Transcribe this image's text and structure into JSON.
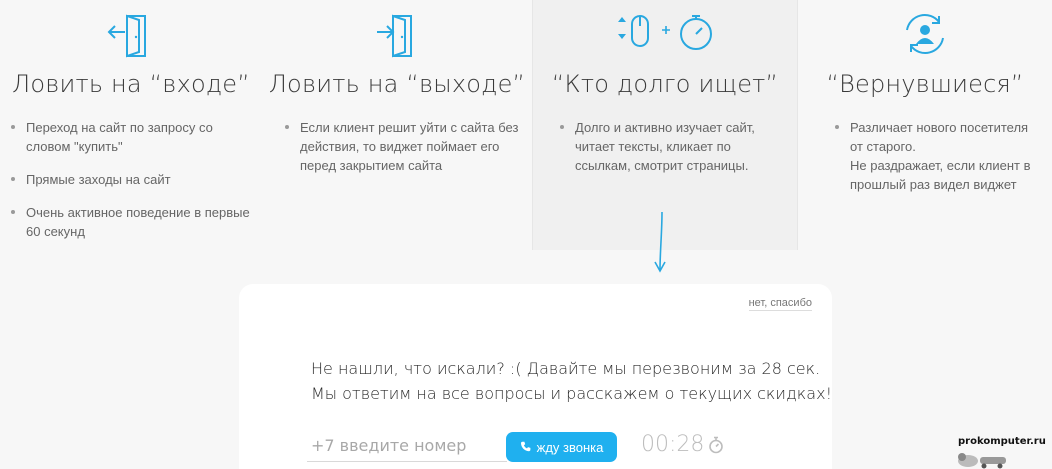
{
  "colors": {
    "accent": "#1fb0ef",
    "icon": "#29a8e0"
  },
  "columns": [
    {
      "icon": "door-enter-icon",
      "title": "Ловить на “входе”",
      "items": [
        "Переход на сайт по запросу со словом \"купить\"",
        "Прямые заходы на сайт",
        "Очень активное поведение в первые 60 секунд"
      ]
    },
    {
      "icon": "door-exit-icon",
      "title": "Ловить на “выходе”",
      "items": [
        "Если клиент решит уйти с сайта без действия, то виджет поймает его перед закрытием сайта"
      ]
    },
    {
      "icon": "mouse-scroll-stopwatch-icon",
      "title": "“Кто долго ищет”",
      "items": [
        "Долго и активно изучает сайт, читает тексты, кликает по ссылкам, смотрит страницы."
      ]
    },
    {
      "icon": "returning-user-icon",
      "title": "“Вернувшиеся”",
      "items": [
        "Различает нового посетителя от старого.\nНе раздражает, если клиент в прошлый раз видел виджет"
      ]
    }
  ],
  "widget": {
    "close_link": "нет, спасибо",
    "message_line1": "Не нашли, что искали? :( Давайте мы перезвоним за 28 сек.",
    "message_line2": "Мы ответим на все вопросы и расскажем о текущих скидках!",
    "phone_placeholder": "+7 введите номер",
    "call_button": "жду звонка",
    "timer": "00:28"
  },
  "watermark": {
    "text": "prokomputer.ru"
  }
}
